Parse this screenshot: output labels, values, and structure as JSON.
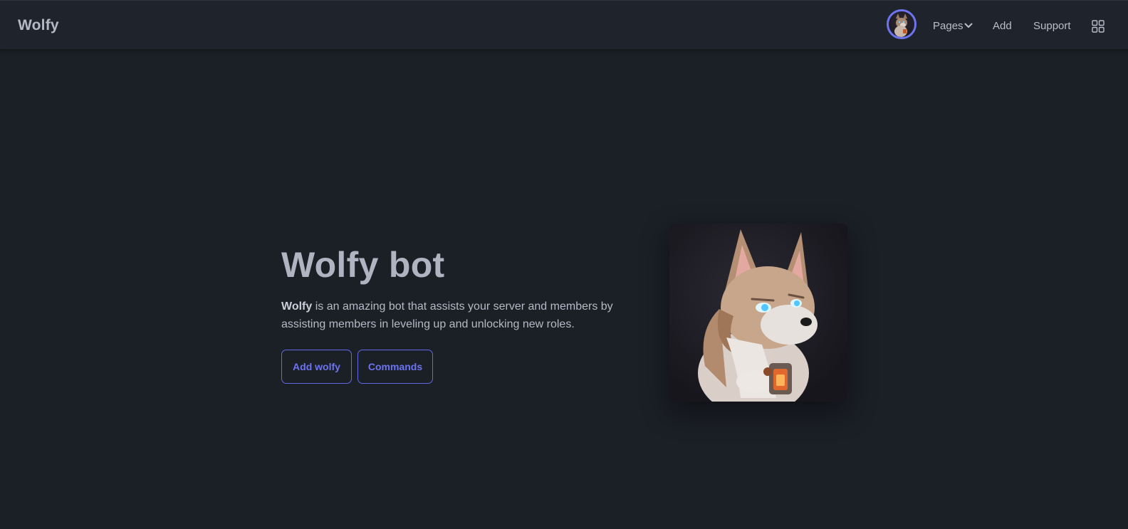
{
  "navbar": {
    "brand": "Wolfy",
    "links": {
      "pages": "Pages",
      "add": "Add",
      "support": "Support"
    },
    "icons": {
      "avatar": "wolf-avatar",
      "pages_dropdown": "chevron-down-icon",
      "apps": "grid-icon"
    }
  },
  "hero": {
    "title": "Wolfy bot",
    "description_bold": "Wolfy",
    "description_rest": " is an amazing bot that assists your server and members by assisting members in leveling up and unlocking new roles.",
    "buttons": {
      "add": "Add wolfy",
      "commands": "Commands"
    },
    "image": "wolf-illustration"
  },
  "colors": {
    "background": "#1b1f26",
    "navbar": "#1f242c",
    "accent": "#6c73f2",
    "text": "#b8bfca"
  }
}
